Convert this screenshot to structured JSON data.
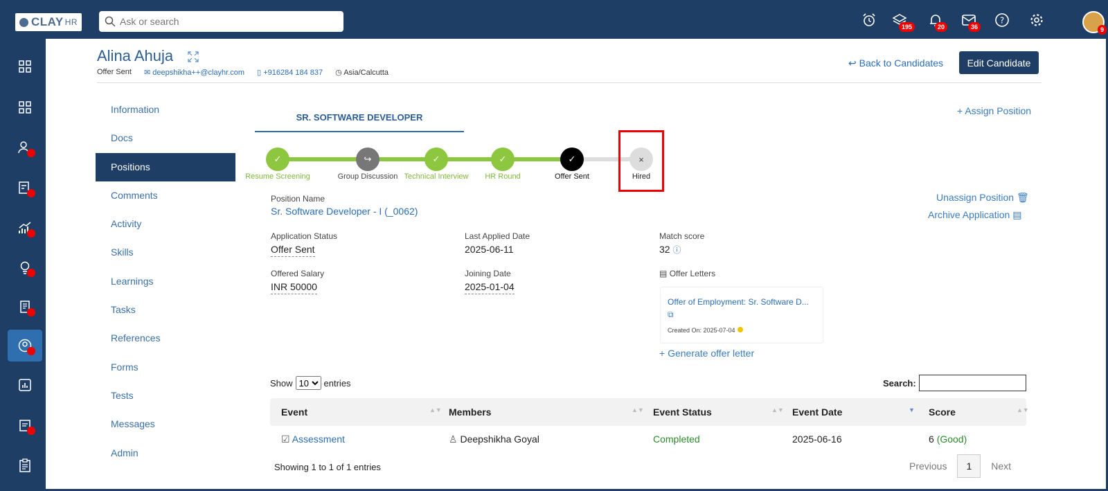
{
  "topbar": {
    "logo_text": "CLAY",
    "logo_suffix": "HR",
    "search_placeholder": "Ask or search",
    "badges": {
      "layers": "195",
      "bell": "20",
      "mail": "36",
      "avatar": "9"
    }
  },
  "candidate": {
    "name": "Alina Ahuja",
    "status": "Offer Sent",
    "email": "deepshikha++@clayhr.com",
    "phone": "+916284 184 837",
    "timezone": "Asia/Calcutta"
  },
  "actions": {
    "back": "Back to Candidates",
    "edit": "Edit Candidate",
    "assign_position": "Assign Position",
    "unassign_position": "Unassign Position",
    "archive_application": "Archive Application",
    "generate_offer": "Generate offer letter"
  },
  "nav": [
    "Information",
    "Docs",
    "Positions",
    "Comments",
    "Activity",
    "Skills",
    "Learnings",
    "Tasks",
    "References",
    "Forms",
    "Tests",
    "Messages",
    "Admin"
  ],
  "position_tab": "SR. SOFTWARE DEVELOPER",
  "pipeline": [
    {
      "label": "Resume Screening",
      "symbol": "✓",
      "color": "#8dc63f",
      "label_color": "#7db83a"
    },
    {
      "label": "Group Discussion",
      "symbol": "↪",
      "color": "#777777",
      "label_color": "#444444"
    },
    {
      "label": "Technical Interview",
      "symbol": "✓",
      "color": "#8dc63f",
      "label_color": "#7db83a"
    },
    {
      "label": "HR Round",
      "symbol": "✓",
      "color": "#8dc63f",
      "label_color": "#7db83a"
    },
    {
      "label": "Offer Sent",
      "symbol": "✓",
      "color": "#000000",
      "label_color": "#111111"
    },
    {
      "label": "Hired",
      "symbol": "×",
      "color": "#dddddd",
      "label_color": "#222222"
    }
  ],
  "details": {
    "position_name_label": "Position Name",
    "position_name": "Sr. Software Developer - I (_0062)",
    "application_status_label": "Application Status",
    "application_status": "Offer Sent",
    "last_applied_label": "Last Applied Date",
    "last_applied": "2025-06-11",
    "match_score_label": "Match score",
    "match_score": "32",
    "offered_salary_label": "Offered Salary",
    "offered_salary": "INR 50000",
    "joining_date_label": "Joining Date",
    "joining_date": "2025-01-04",
    "offer_letters_label": "Offer Letters",
    "offer_title": "Offer of Employment: Sr. Software D...",
    "offer_created": "Created On: 2025-07-04"
  },
  "table": {
    "show": "Show",
    "entries_value": "10",
    "entries": "entries",
    "search_label": "Search:",
    "columns": [
      "Event",
      "Members",
      "Event Status",
      "Event Date",
      "Score"
    ],
    "rows": [
      {
        "event": "Assessment",
        "member": "Deepshikha Goyal",
        "status": "Completed",
        "date": "2025-06-16",
        "score": "6",
        "score_note": "(Good)"
      }
    ],
    "showing": "Showing 1 to 1 of 1 entries",
    "previous": "Previous",
    "page": "1",
    "next": "Next"
  }
}
